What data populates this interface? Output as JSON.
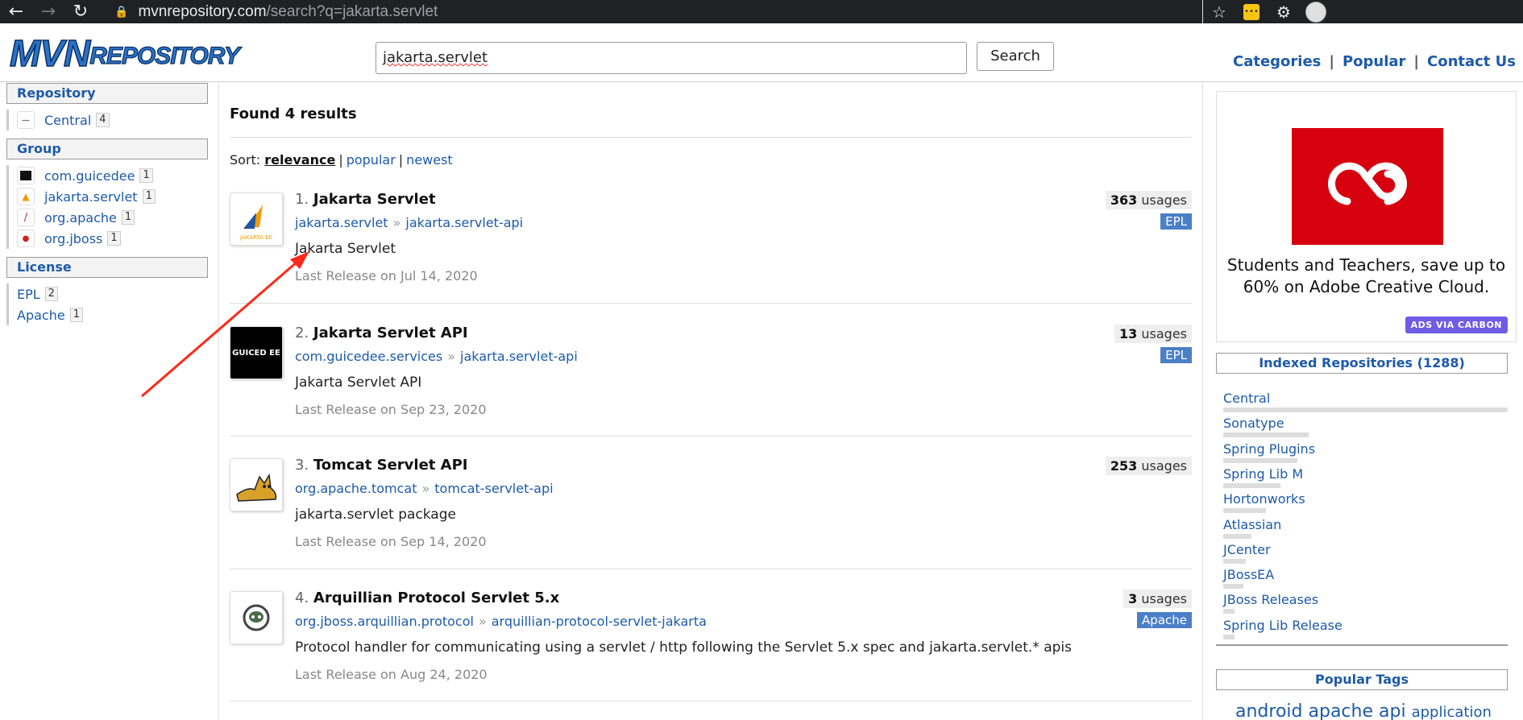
{
  "browser": {
    "url_host": "mvnrepository.com",
    "url_path": "/search?q=jakarta.servlet",
    "back_icon": "arrow-left-icon",
    "forward_icon": "arrow-right-icon",
    "reload_icon": "reload-icon",
    "lock_icon": "lock-icon",
    "star_icon": "star-icon",
    "extension_icon": "puzzle-icon"
  },
  "header": {
    "logo_big": "MVN",
    "logo_small": "REPOSITORY",
    "search_value": "jakarta.servlet",
    "search_button": "Search",
    "nav": [
      "Categories",
      "Popular",
      "Contact Us"
    ],
    "nav_sep": "|"
  },
  "sidebar": {
    "repository_title": "Repository",
    "repository_items": [
      {
        "label": "Central",
        "count": "4"
      }
    ],
    "group_title": "Group",
    "group_items": [
      {
        "label": "com.guicedee",
        "count": "1"
      },
      {
        "label": "jakarta.servlet",
        "count": "1"
      },
      {
        "label": "org.apache",
        "count": "1"
      },
      {
        "label": "org.jboss",
        "count": "1"
      }
    ],
    "license_title": "License",
    "license_items": [
      {
        "label": "EPL",
        "count": "2"
      },
      {
        "label": "Apache",
        "count": "1"
      }
    ]
  },
  "main": {
    "found": "Found 4 results",
    "sort_label": "Sort:",
    "sort_options": [
      "relevance",
      "popular",
      "newest"
    ],
    "sort_sep": "|",
    "results": [
      {
        "num": "1.",
        "name": "Jakarta Servlet",
        "group": "jakarta.servlet",
        "artifact": "jakarta.servlet-api",
        "desc": "Jakarta Servlet",
        "release": "Last Release on Jul 14, 2020",
        "usages": "363",
        "usages_label": "usages",
        "license": "EPL"
      },
      {
        "num": "2.",
        "name": "Jakarta Servlet API",
        "group": "com.guicedee.services",
        "artifact": "jakarta.servlet-api",
        "desc": "Jakarta Servlet API",
        "release": "Last Release on Sep 23, 2020",
        "usages": "13",
        "usages_label": "usages",
        "license": "EPL"
      },
      {
        "num": "3.",
        "name": "Tomcat Servlet API",
        "group": "org.apache.tomcat",
        "artifact": "tomcat-servlet-api",
        "desc": "jakarta.servlet package",
        "release": "Last Release on Sep 14, 2020",
        "usages": "253",
        "usages_label": "usages",
        "license": ""
      },
      {
        "num": "4.",
        "name": "Arquillian Protocol Servlet 5.x",
        "group": "org.jboss.arquillian.protocol",
        "artifact": "arquillian-protocol-servlet-jakarta",
        "desc": "Protocol handler for communicating using a servlet / http following the Servlet 5.x spec and jakarta.servlet.* apis",
        "release": "Last Release on Aug 24, 2020",
        "usages": "3",
        "usages_label": "usages",
        "license": "Apache"
      }
    ],
    "arrow_sep": "»",
    "thumb_labels": {
      "jakarta": "JAKARTA EE",
      "guiced": "GUICED EE"
    }
  },
  "right": {
    "ad_text": "Students and Teachers, save up to 60% on Adobe Creative Cloud.",
    "ad_via": "ADS VIA CARBON",
    "indexed_title": "Indexed Repositories (1288)",
    "repos": [
      {
        "name": "Central",
        "level": 1.0
      },
      {
        "name": "Sonatype",
        "level": 0.3
      },
      {
        "name": "Spring Plugins",
        "level": 0.26
      },
      {
        "name": "Spring Lib M",
        "level": 0.2
      },
      {
        "name": "Hortonworks",
        "level": 0.15
      },
      {
        "name": "Atlassian",
        "level": 0.1
      },
      {
        "name": "JCenter",
        "level": 0.08
      },
      {
        "name": "JBossEA",
        "level": 0.07
      },
      {
        "name": "JBoss Releases",
        "level": 0.04
      },
      {
        "name": "Spring Lib Release",
        "level": 0.04
      }
    ],
    "popular_tags_title": "Popular Tags",
    "tags": [
      "android",
      "apache",
      "api",
      "application"
    ]
  },
  "colors": {
    "link": "#1d5aa8",
    "license_badge": "#4b7fc7",
    "ad_red": "#d7000f",
    "carbon": "#6f5ce6",
    "annotation": "#ff2a1a"
  }
}
